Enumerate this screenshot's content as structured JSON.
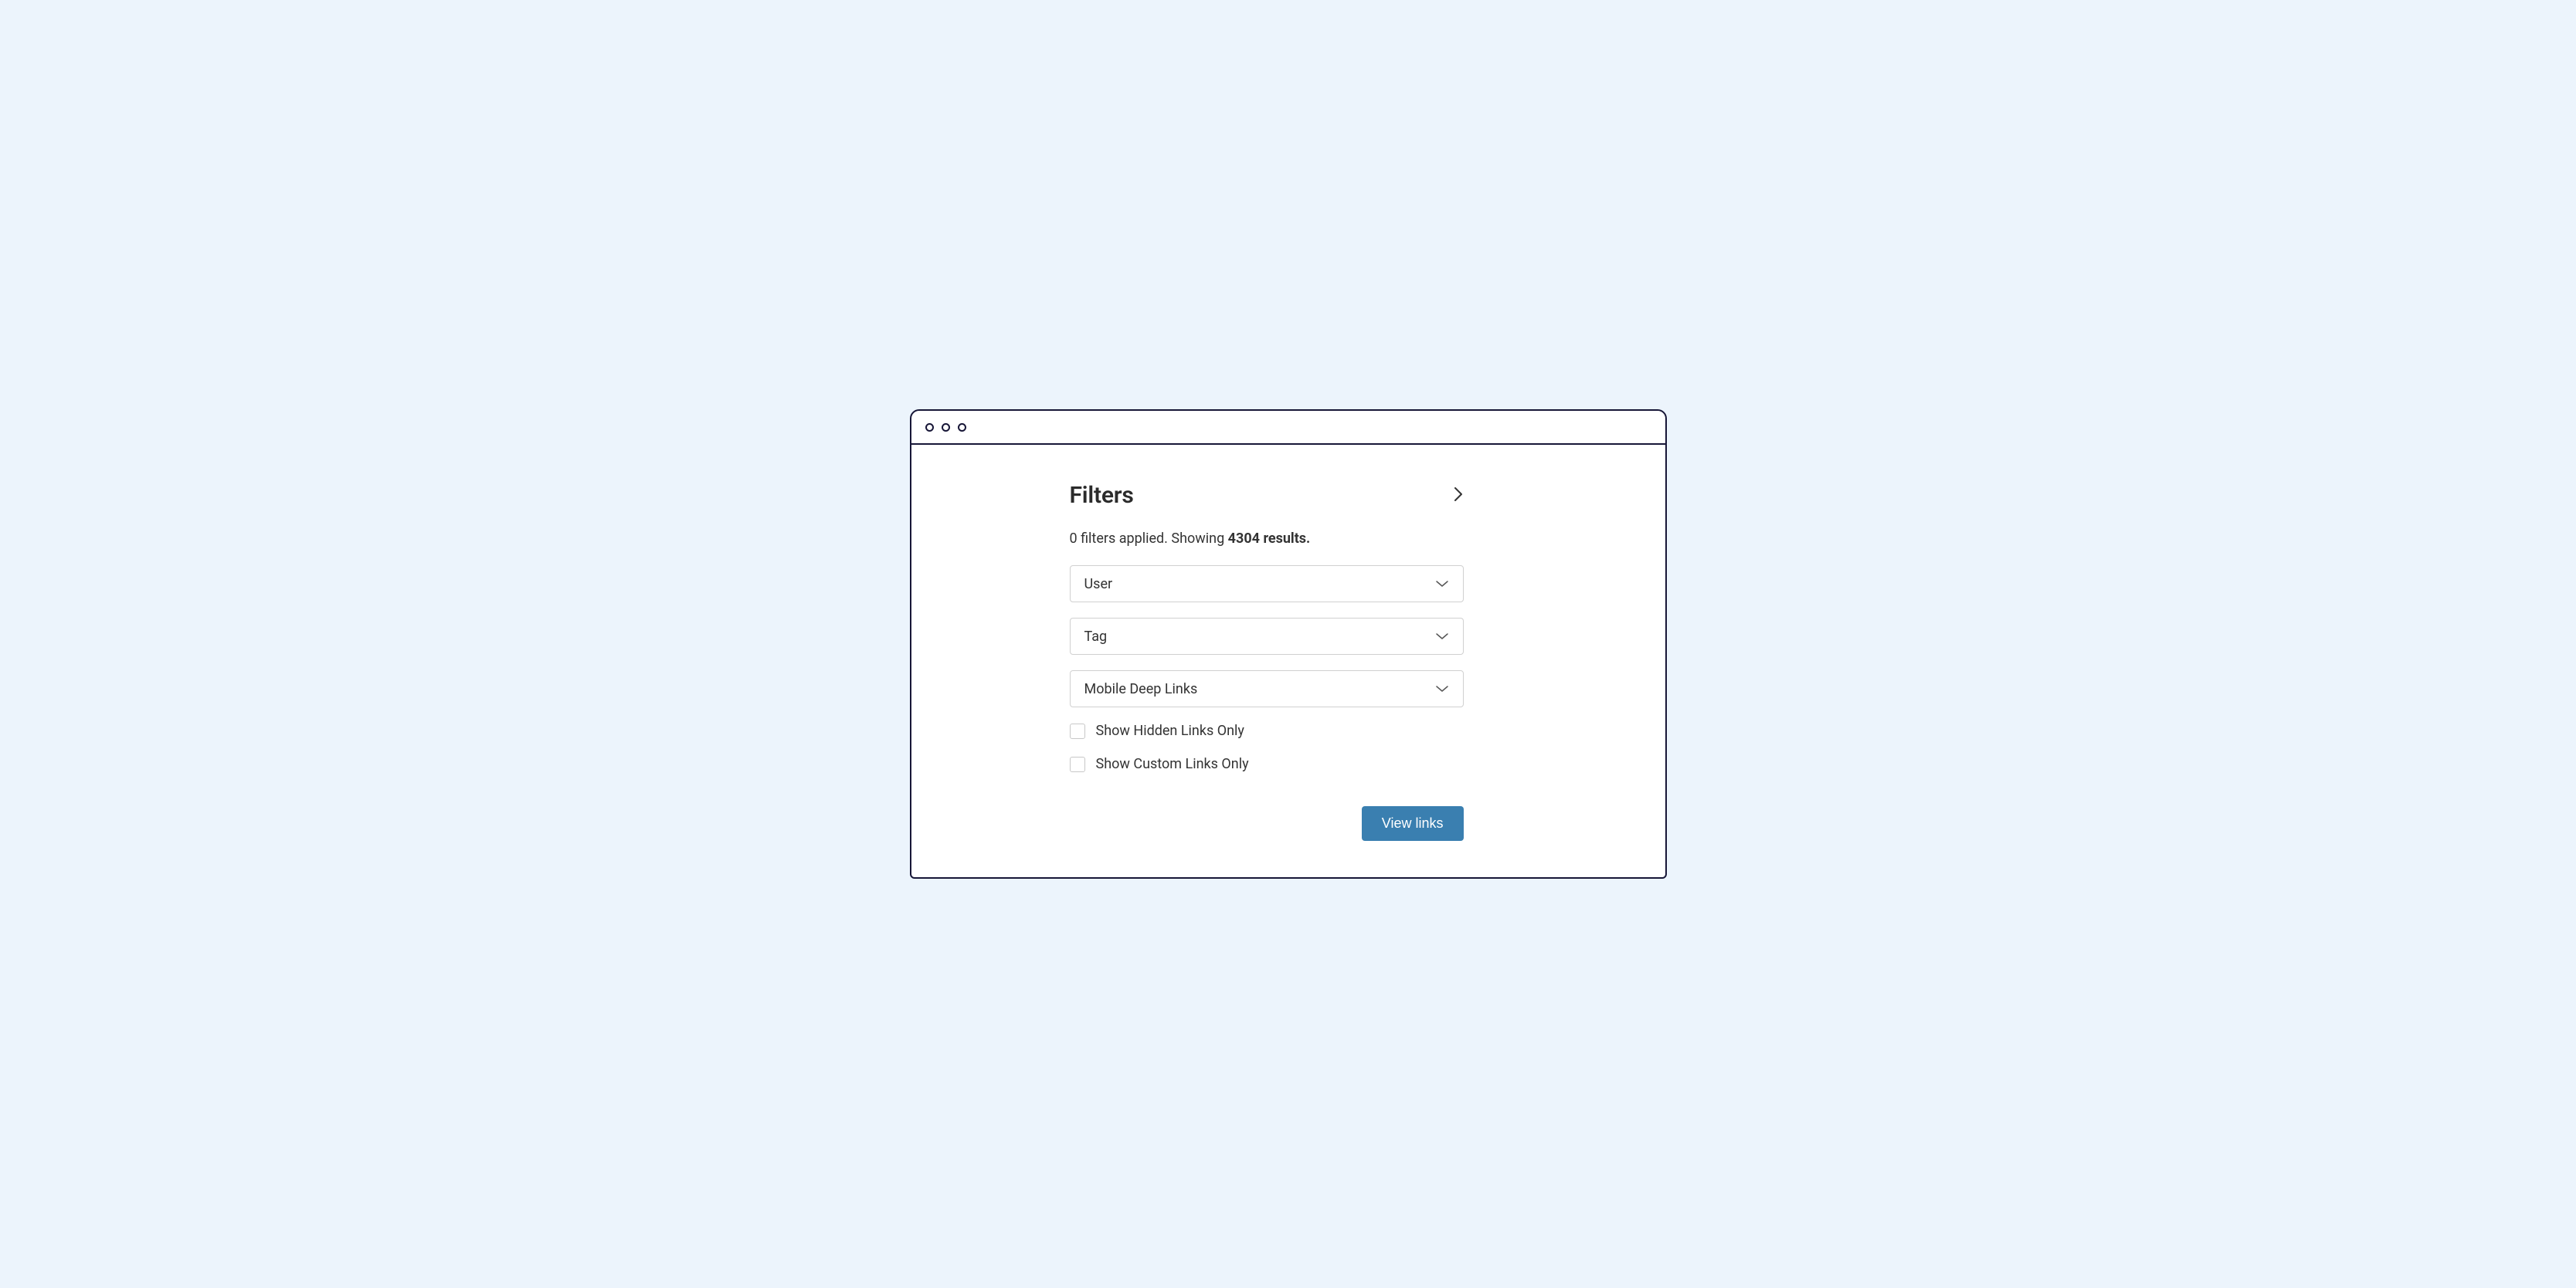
{
  "heading": "Filters",
  "status": {
    "prefix": "0 filters applied. Showing ",
    "count": "4304 results."
  },
  "selects": {
    "user": "User",
    "tag": "Tag",
    "mobile": "Mobile Deep Links"
  },
  "checkboxes": {
    "hidden": "Show Hidden Links Only",
    "custom": "Show Custom Links Only"
  },
  "buttons": {
    "view": "View links"
  }
}
